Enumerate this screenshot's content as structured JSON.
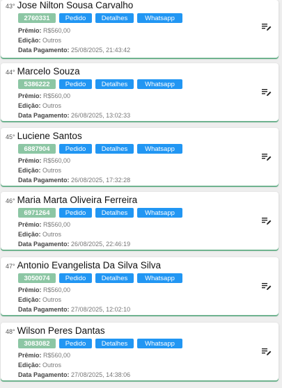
{
  "labels": {
    "premio": "Prêmio:",
    "edicao": "Edição:",
    "data_pagamento": "Data Pagamento:",
    "pedido_btn": "Pedido",
    "detalhes_btn": "Detalhes",
    "whatsapp_btn": "Whatsapp"
  },
  "colors": {
    "badge": "#8cc6a4",
    "button": "#2196f3",
    "card_shadow": "#6fb38f"
  },
  "icons": {
    "edit": "edit-list-icon"
  },
  "winners": [
    {
      "rank": "43°",
      "name": "Jose Nilton Sousa Carvalho",
      "code": "2760331",
      "premio": "R$560,00",
      "edicao": "Outros",
      "data_pagamento": "25/08/2025, 21:43:42"
    },
    {
      "rank": "44°",
      "name": "Marcelo Souza",
      "code": "5386222",
      "premio": "R$560,00",
      "edicao": "Outros",
      "data_pagamento": "26/08/2025, 13:02:33"
    },
    {
      "rank": "45°",
      "name": "Luciene Santos",
      "code": "6887904",
      "premio": "R$560,00",
      "edicao": "Outros",
      "data_pagamento": "26/08/2025, 17:32:28"
    },
    {
      "rank": "46°",
      "name": "Maria Marta Oliveira Ferreira",
      "code": "6971264",
      "premio": "R$560,00",
      "edicao": "Outros",
      "data_pagamento": "26/08/2025, 22:46:19"
    },
    {
      "rank": "47°",
      "name": "Antonio Evangelista Da Silva Silva",
      "code": "3050074",
      "premio": "R$560,00",
      "edicao": "Outros",
      "data_pagamento": "27/08/2025, 12:02:10"
    },
    {
      "rank": "48°",
      "name": "Wilson Peres Dantas",
      "code": "3083082",
      "premio": "R$560,00",
      "edicao": "Outros",
      "data_pagamento": "27/08/2025, 14:38:06"
    }
  ]
}
